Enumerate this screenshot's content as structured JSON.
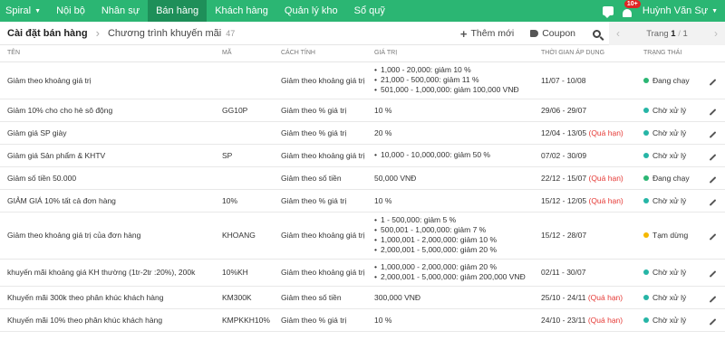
{
  "topbar": {
    "brand": "Spiral",
    "nav": [
      "Nội bộ",
      "Nhân sự",
      "Bán hàng",
      "Khách hàng",
      "Quản lý kho",
      "Sổ quỹ"
    ],
    "active_index": 2,
    "notification_badge": "10+",
    "user_name": "Huỳnh Văn Sự"
  },
  "subbar": {
    "breadcrumb_root": "Cài đặt bán hàng",
    "breadcrumb_current": "Chương trình khuyến mãi",
    "count": "47",
    "add_label": "Thêm mới",
    "coupon_label": "Coupon",
    "page_label": "Trang",
    "page_current": "1",
    "page_total": "1"
  },
  "table": {
    "headers": [
      "TÊN",
      "MÃ",
      "CÁCH TÍNH",
      "GIÁ TRỊ",
      "THỜI GIAN ÁP DỤNG",
      "TRẠNG THÁI"
    ],
    "rows": [
      {
        "name": "Giảm theo khoảng giá trị",
        "code": "",
        "method": "Giảm theo khoảng giá trị",
        "values": [
          "1,000 - 20,000: giảm 10 %",
          "21,000 - 500,000: giảm 11 %",
          "501,000 - 1,000,000: giảm 100,000 VNĐ"
        ],
        "time": "11/07 - 10/08",
        "overdue": "",
        "status": "Đang chạy",
        "status_color": "#2bb673"
      },
      {
        "name": "Giảm 10% cho cho hè sô động",
        "code": "GG10P",
        "method": "Giảm theo % giá trị",
        "value": "10 %",
        "time": "29/06 - 29/07",
        "overdue": "",
        "status": "Chờ xử lý",
        "status_color": "#26b5a6"
      },
      {
        "name": "Giảm giá SP giày",
        "code": "",
        "method": "Giảm theo % giá trị",
        "value": "20 %",
        "time": "12/04 - 13/05",
        "overdue": "(Quá hạn)",
        "status": "Chờ xử lý",
        "status_color": "#26b5a6"
      },
      {
        "name": "Giảm giá Sản phẩm & KHTV",
        "code": "SP",
        "method": "Giảm theo khoảng giá trị",
        "values": [
          "10,000 - 10,000,000: giảm 50 %"
        ],
        "time": "07/02 - 30/09",
        "overdue": "",
        "status": "Chờ xử lý",
        "status_color": "#26b5a6"
      },
      {
        "name": "Giảm số tiền 50.000",
        "code": "",
        "method": "Giảm theo số tiền",
        "value": "50,000 VNĐ",
        "time": "22/12 - 15/07",
        "overdue": "(Quá hạn)",
        "status": "Đang chạy",
        "status_color": "#2bb673"
      },
      {
        "name": "GIẢM GIÁ 10% tất cả đơn hàng",
        "code": "10%",
        "method": "Giảm theo % giá trị",
        "value": "10 %",
        "time": "15/12 - 12/05",
        "overdue": "(Quá hạn)",
        "status": "Chờ xử lý",
        "status_color": "#26b5a6"
      },
      {
        "name": "Giảm theo khoảng giá trị của đơn hàng",
        "code": "KHOANG",
        "method": "Giảm theo khoảng giá trị",
        "values": [
          "1 - 500,000: giảm 5 %",
          "500,001 - 1,000,000: giảm 7 %",
          "1,000,001 - 2,000,000: giảm 10 %",
          "2,000,001 - 5,000,000: giảm 20 %"
        ],
        "time": "15/12 - 28/07",
        "overdue": "",
        "status": "Tạm dừng",
        "status_color": "#f5b800"
      },
      {
        "name": "khuyến mãi khoảng giá KH thường (1tr-2tr :20%), 200k",
        "code": "10%KH",
        "method": "Giảm theo khoảng giá trị",
        "values": [
          "1,000,000 - 2,000,000: giảm 20 %",
          "2,000,001 - 5,000,000: giảm 200,000 VNĐ"
        ],
        "time": "02/11 - 30/07",
        "overdue": "",
        "status": "Chờ xử lý",
        "status_color": "#26b5a6"
      },
      {
        "name": "Khuyến mãi 300k theo phân khúc khách hàng",
        "code": "KM300K",
        "method": "Giảm theo số tiền",
        "value": "300,000 VNĐ",
        "time": "25/10 - 24/11",
        "overdue": "(Quá hạn)",
        "status": "Chờ xử lý",
        "status_color": "#26b5a6"
      },
      {
        "name": "Khuyến mãi 10% theo phân khúc khách hàng",
        "code": "KMPKKH10%",
        "method": "Giảm theo % giá trị",
        "value": "10 %",
        "time": "24/10 - 23/11",
        "overdue": "(Quá hạn)",
        "status": "Chờ xử lý",
        "status_color": "#26b5a6"
      }
    ]
  }
}
